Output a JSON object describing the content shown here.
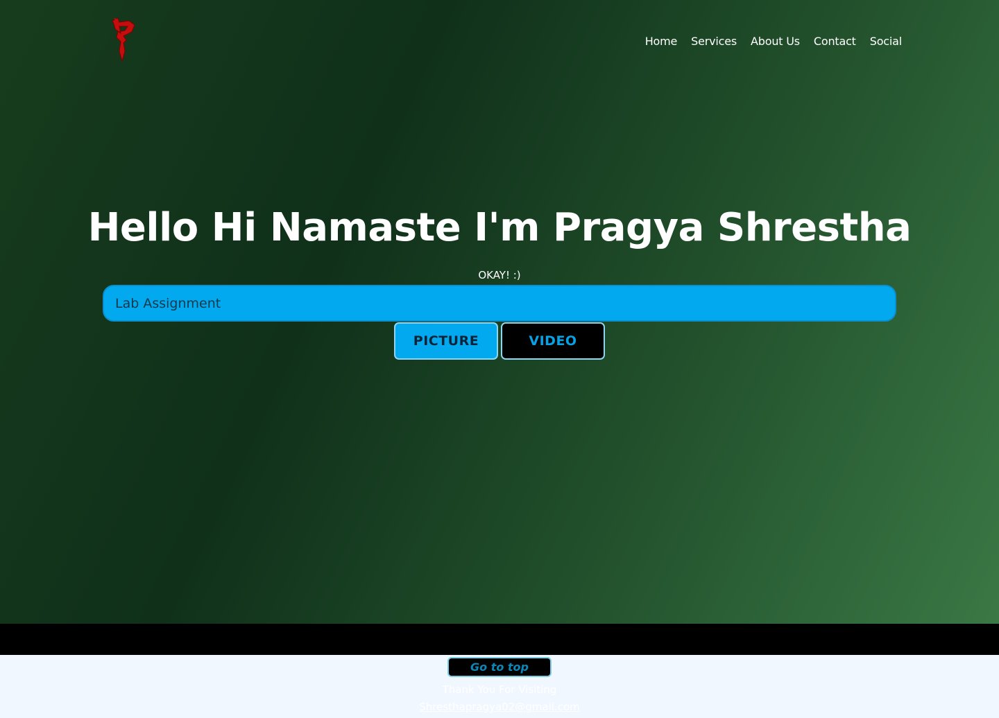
{
  "header": {
    "logo": {
      "icon": "p-letter-logo-icon",
      "color": "#c40d0d"
    },
    "nav": [
      "Home",
      "Services",
      "About Us",
      "Contact",
      "Social"
    ]
  },
  "hero": {
    "title": "Hello Hi Namaste I'm Pragya Shrestha",
    "subtitle": "OKAY! :)",
    "search": {
      "value": "Lab Assignment",
      "placeholder": ""
    },
    "buttons": {
      "picture": "PICTURE",
      "video": "VIDEO"
    }
  },
  "footer": {
    "go_top": "Go to top",
    "thanks": "Thank You For Visiting",
    "email": "Shresthapragya02@gmail.com"
  },
  "colors": {
    "accent_blue": "#03a9ee",
    "hero_gradient": [
      "#173c1d",
      "#10301a",
      "#214f2b",
      "#3a7845"
    ],
    "footer_bg": "#f0f7ff"
  }
}
